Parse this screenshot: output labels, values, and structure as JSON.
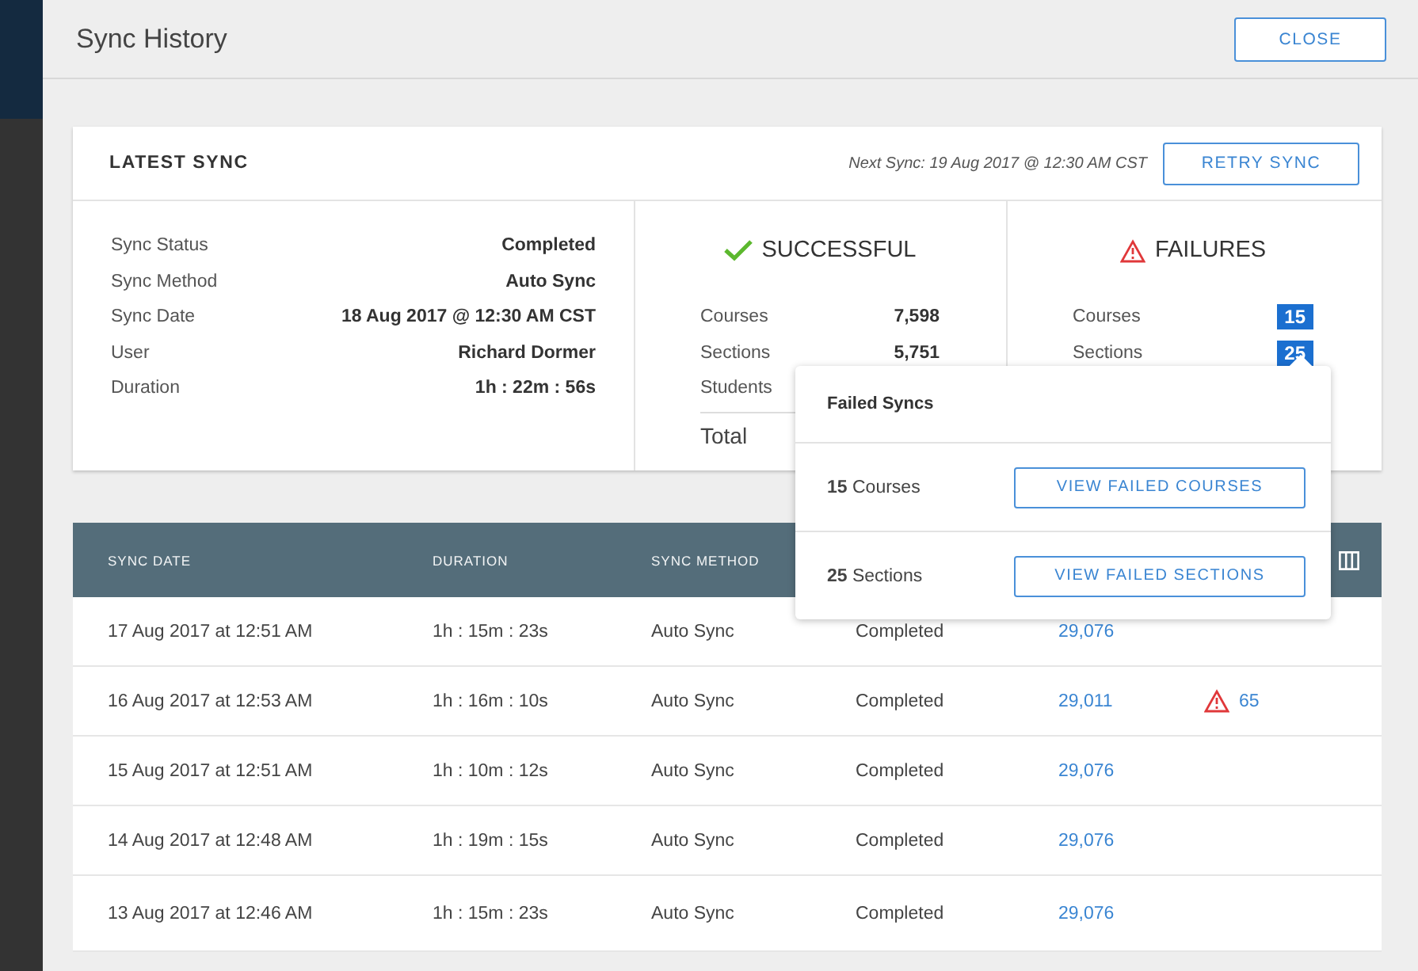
{
  "window": {
    "title": "Sync History",
    "close_button": "CLOSE"
  },
  "latest_sync": {
    "title": "LATEST SYNC",
    "next_sync": "Next Sync: 19 Aug 2017 @ 12:30 AM CST",
    "retry_button": "RETRY SYNC",
    "details": [
      {
        "label": "Sync Status",
        "value": "Completed"
      },
      {
        "label": "Sync Method",
        "value": "Auto Sync"
      },
      {
        "label": "Sync Date",
        "value": "18 Aug 2017 @ 12:30 AM CST"
      },
      {
        "label": "User",
        "value": "Richard Dormer"
      },
      {
        "label": "Duration",
        "value": "1h : 22m : 56s"
      }
    ],
    "successful": {
      "title": "SUCCESSFUL",
      "rows": [
        {
          "label": "Courses",
          "value": "7,598"
        },
        {
          "label": "Sections",
          "value": "5,751"
        },
        {
          "label": "Students"
        }
      ],
      "total_label": "Total"
    },
    "failures": {
      "title": "FAILURES",
      "rows": [
        {
          "label": "Courses",
          "value": "15"
        },
        {
          "label": "Sections",
          "value": "25"
        }
      ]
    }
  },
  "popover": {
    "title": "Failed Syncs",
    "rows": [
      {
        "count": "15",
        "label": "Courses",
        "button": "VIEW FAILED COURSES"
      },
      {
        "count": "25",
        "label": "Sections",
        "button": "VIEW FAILED SECTIONS"
      }
    ]
  },
  "table": {
    "columns": [
      "SYNC DATE",
      "DURATION",
      "SYNC METHOD"
    ],
    "rows": [
      {
        "date": "17 Aug 2017 at 12:51 AM",
        "duration": "1h : 15m : 23s",
        "method": "Auto Sync",
        "status": "Completed",
        "count": "29,076"
      },
      {
        "date": "16 Aug 2017 at 12:53 AM",
        "duration": "1h : 16m : 10s",
        "method": "Auto Sync",
        "status": "Completed",
        "count": "29,011",
        "failures": "65"
      },
      {
        "date": "15 Aug 2017 at 12:51 AM",
        "duration": "1h : 10m : 12s",
        "method": "Auto Sync",
        "status": "Completed",
        "count": "29,076"
      },
      {
        "date": "14 Aug 2017 at 12:48 AM",
        "duration": "1h : 19m : 15s",
        "method": "Auto Sync",
        "status": "Completed",
        "count": "29,076"
      },
      {
        "date": "13 Aug 2017 at 12:46 AM",
        "duration": "1h : 15m : 23s",
        "method": "Auto Sync",
        "status": "Completed",
        "count": "29,076"
      }
    ]
  }
}
